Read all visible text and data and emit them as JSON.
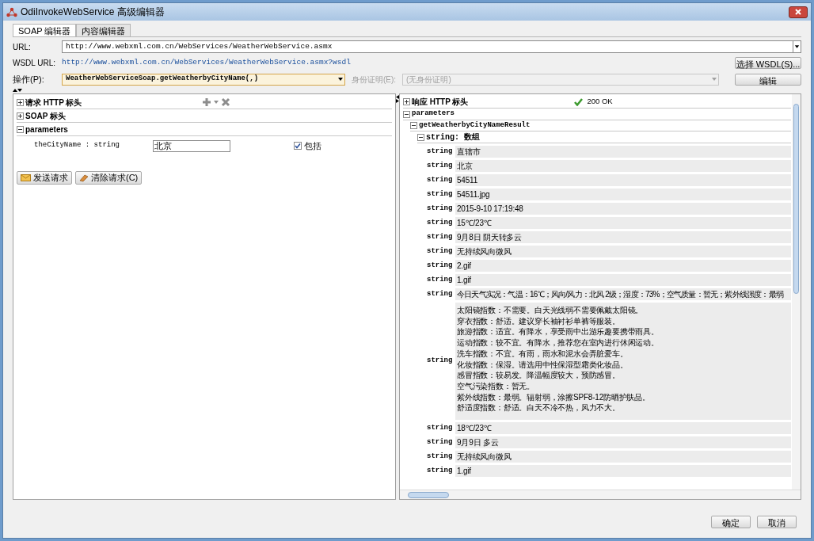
{
  "window": {
    "title": "OdiInvokeWebService 高级编辑器"
  },
  "tabs": [
    {
      "label": "SOAP 编辑器",
      "selected": true
    },
    {
      "label": "内容编辑器",
      "selected": false
    }
  ],
  "url": {
    "label": "URL:",
    "value": "http://www.webxml.com.cn/WebServices/WeatherWebService.asmx"
  },
  "wsdl_url": {
    "label": "WSDL URL:",
    "value": "http://www.webxml.com.cn/WebServices/WeatherWebService.asmx?wsdl"
  },
  "select_wsdl_button": "选择 WSDL(S)...",
  "operation": {
    "label": "操作(P):",
    "value": "WeatherWebServiceSoap.getWeatherbyCityName(,)"
  },
  "credential": {
    "label": "身份证明(E):",
    "placeholder": "(无身份证明)",
    "disabled": true
  },
  "edit_button": "编辑",
  "request": {
    "sections": [
      {
        "label": "请求 HTTP 标头",
        "expanded": false
      },
      {
        "label": "SOAP 标头",
        "expanded": false
      },
      {
        "label": "parameters",
        "expanded": true
      }
    ],
    "parameters": [
      {
        "name": "theCityName : string",
        "value": "北京",
        "include_label": "包括",
        "checked": true
      }
    ],
    "actions": [
      {
        "label": "发送请求"
      },
      {
        "label": "清除请求(C)"
      }
    ]
  },
  "response": {
    "header": {
      "label": "响应 HTTP 标头",
      "expanded": false,
      "status": "200 OK"
    },
    "parameters": {
      "label": "parameters",
      "expanded": true
    },
    "result": {
      "label": "getWeatherbyCityNameResult",
      "expanded": true
    },
    "array": {
      "label": "string: 数组",
      "expanded": true
    },
    "rows": [
      {
        "type": "string",
        "lines": [
          "直辖市"
        ]
      },
      {
        "type": "string",
        "lines": [
          "北京"
        ]
      },
      {
        "type": "string",
        "lines": [
          "54511"
        ]
      },
      {
        "type": "string",
        "lines": [
          "54511.jpg"
        ]
      },
      {
        "type": "string",
        "lines": [
          "2015-9-10 17:19:48"
        ]
      },
      {
        "type": "string",
        "lines": [
          "15℃/23℃"
        ]
      },
      {
        "type": "string",
        "lines": [
          "9月8日 阴天转多云"
        ]
      },
      {
        "type": "string",
        "lines": [
          "无持续风向微风"
        ]
      },
      {
        "type": "string",
        "lines": [
          "2.gif"
        ]
      },
      {
        "type": "string",
        "lines": [
          "1.gif"
        ]
      },
      {
        "type": "string",
        "lines": [
          "今日天气实况：气温：16℃；风向/风力：北风 2级；湿度：73%；空气质量：暂无；紫外线强度：最弱"
        ]
      },
      {
        "type": "string",
        "lines": [
          "太阳镜指数：不需要。白天光线弱不需要佩戴太阳镜。",
          "穿衣指数：舒适。建议穿长袖衬衫单裤等服装。",
          "旅游指数：适宜。有降水，享受雨中出游乐趣要携带雨具。",
          "运动指数：较不宜。有降水，推荐您在室内进行休闲运动。",
          "洗车指数：不宜。有雨，雨水和泥水会弄脏爱车。",
          "化妆指数：保湿。请选用中性保湿型霜类化妆品。",
          "感冒指数：较易发。降温幅度较大，预防感冒。",
          "空气污染指数：暂无。",
          "紫外线指数：最弱。辐射弱，涂擦SPF8-12防晒护肤品。",
          "舒适度指数：舒适。白天不冷不热，风力不大。"
        ]
      },
      {
        "type": "string",
        "lines": [
          "18℃/23℃"
        ]
      },
      {
        "type": "string",
        "lines": [
          "9月9日 多云"
        ]
      },
      {
        "type": "string",
        "lines": [
          "无持续风向微风"
        ]
      },
      {
        "type": "string",
        "lines": [
          "1.gif"
        ]
      }
    ]
  },
  "footer_buttons": [
    {
      "label": "确定"
    },
    {
      "label": "取消"
    }
  ]
}
